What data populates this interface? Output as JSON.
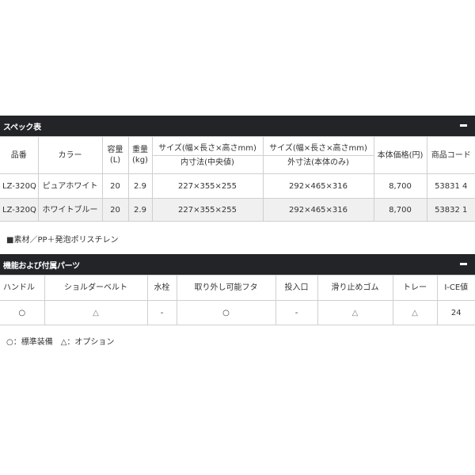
{
  "spec": {
    "title": "スペック表",
    "headers": {
      "model": "品番",
      "color": "カラー",
      "capacity_l1": "容量",
      "capacity_l2": "(L)",
      "weight_l1": "重量",
      "weight_l2": "(kg)",
      "inner_l1": "サイズ(幅×長さ×高さmm)",
      "inner_l2": "内寸法(中央値)",
      "outer_l1": "サイズ(幅×長さ×高さmm)",
      "outer_l2": "外寸法(本体のみ)",
      "price": "本体価格(円)",
      "code": "商品コード"
    },
    "rows": [
      {
        "model": "LZ-320Q",
        "color": "ピュアホワイト",
        "capacity": "20",
        "weight": "2.9",
        "inner": "227×355×255",
        "outer": "292×465×316",
        "price": "8,700",
        "code": "53831 4"
      },
      {
        "model": "LZ-320Q",
        "color": "ホワイトブルー",
        "capacity": "20",
        "weight": "2.9",
        "inner": "227×355×255",
        "outer": "292×465×316",
        "price": "8,700",
        "code": "53832 1"
      }
    ],
    "material_note": "■素材／PP＋発泡ポリスチレン"
  },
  "features": {
    "title": "機能および付属パーツ",
    "headers": [
      "ハンドル",
      "ショルダーベルト",
      "水栓",
      "取り外し可能フタ",
      "投入口",
      "滑り止めゴム",
      "トレー",
      "I-CE値"
    ],
    "values": [
      "○",
      "△",
      "-",
      "○",
      "-",
      "△",
      "△",
      "24"
    ],
    "legend": "○：標準装備　△：オプション"
  }
}
